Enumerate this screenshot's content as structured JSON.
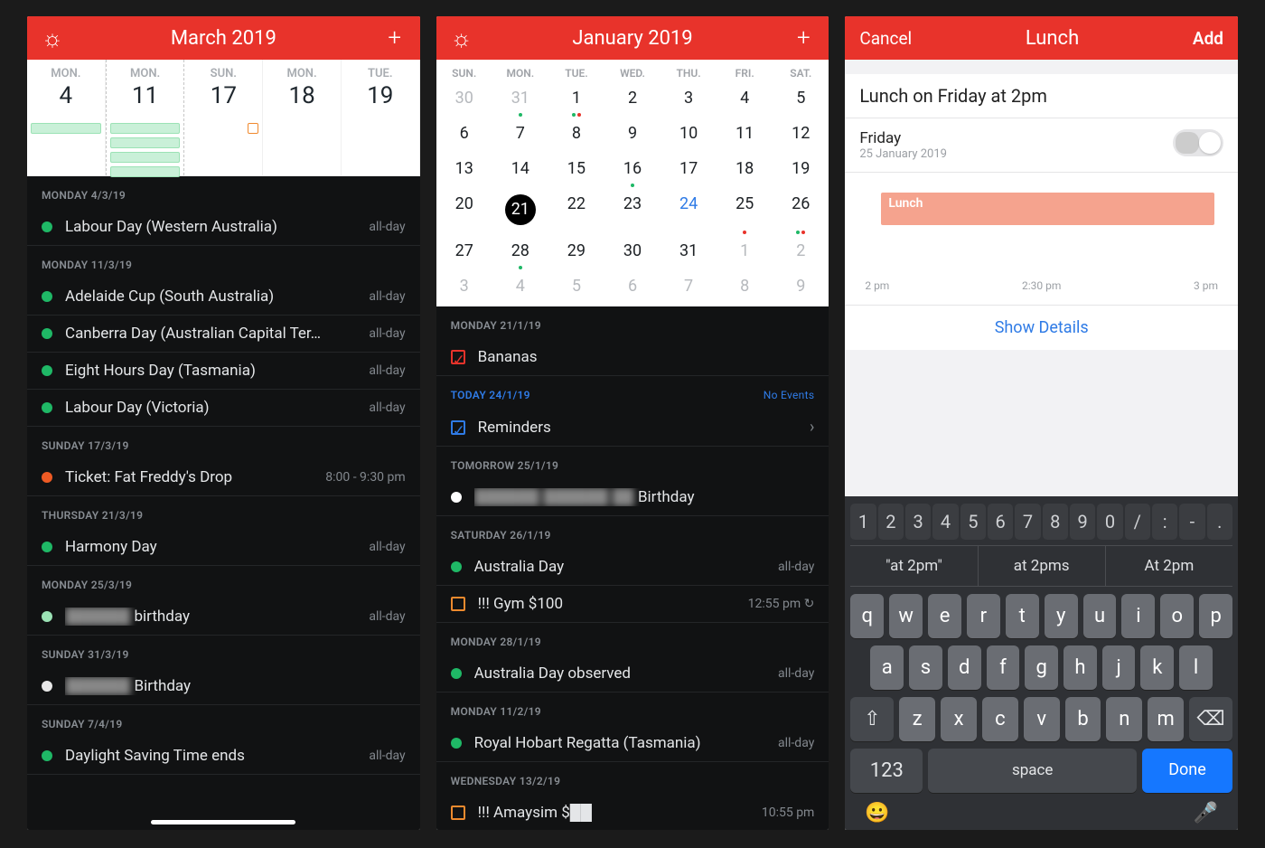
{
  "pane1": {
    "title": "March 2019",
    "days": [
      {
        "dow": "MON.",
        "num": "4"
      },
      {
        "dow": "MON.",
        "num": "11",
        "selected": true
      },
      {
        "dow": "SUN.",
        "num": "17"
      },
      {
        "dow": "MON.",
        "num": "18"
      },
      {
        "dow": "TUE.",
        "num": "19"
      }
    ],
    "groups": [
      {
        "hd": "MONDAY 4/3/19",
        "items": [
          {
            "c": "#1fb866",
            "t": "Labour Day (Western Australia)",
            "m": "all-day"
          }
        ]
      },
      {
        "hd": "MONDAY 11/3/19",
        "items": [
          {
            "c": "#1fb866",
            "t": "Adelaide Cup (South Australia)",
            "m": "all-day"
          },
          {
            "c": "#1fb866",
            "t": "Canberra Day (Australian Capital Ter…",
            "m": "all-day"
          },
          {
            "c": "#1fb866",
            "t": "Eight Hours Day (Tasmania)",
            "m": "all-day"
          },
          {
            "c": "#1fb866",
            "t": "Labour Day (Victoria)",
            "m": "all-day"
          }
        ]
      },
      {
        "hd": "SUNDAY 17/3/19",
        "items": [
          {
            "c": "#ee5a24",
            "t": "Ticket: Fat Freddy's Drop",
            "m": "8:00 - 9:30 pm"
          }
        ]
      },
      {
        "hd": "THURSDAY 21/3/19",
        "items": [
          {
            "c": "#1fb866",
            "t": "Harmony Day",
            "m": "all-day"
          }
        ]
      },
      {
        "hd": "MONDAY 25/3/19",
        "items": [
          {
            "c": "#9be2b5",
            "t": "birthday",
            "m": "all-day",
            "blur": true,
            "prefix": "██████"
          }
        ]
      },
      {
        "hd": "SUNDAY 31/3/19",
        "items": [
          {
            "c": "#e7e7e7",
            "t": "Birthday",
            "m": "",
            "blur": true,
            "prefix": "██████"
          }
        ]
      },
      {
        "hd": "SUNDAY 7/4/19",
        "items": [
          {
            "c": "#1fb866",
            "t": "Daylight Saving Time ends",
            "m": "all-day"
          }
        ]
      }
    ]
  },
  "pane2": {
    "title": "January 2019",
    "dow": [
      "SUN.",
      "MON.",
      "TUE.",
      "WED.",
      "THU.",
      "FRI.",
      "SAT."
    ],
    "grid": [
      [
        {
          "n": "30",
          "dim": 1
        },
        {
          "n": "31",
          "dim": 1,
          "d": [
            "#1fb866"
          ]
        },
        {
          "n": "1",
          "d": [
            "#1fb866",
            "#e8332b"
          ]
        },
        {
          "n": "2"
        },
        {
          "n": "3"
        },
        {
          "n": "4"
        },
        {
          "n": "5"
        }
      ],
      [
        {
          "n": "6"
        },
        {
          "n": "7"
        },
        {
          "n": "8"
        },
        {
          "n": "9"
        },
        {
          "n": "10"
        },
        {
          "n": "11"
        },
        {
          "n": "12"
        }
      ],
      [
        {
          "n": "13"
        },
        {
          "n": "14"
        },
        {
          "n": "15"
        },
        {
          "n": "16",
          "d": [
            "#1fb866"
          ]
        },
        {
          "n": "17"
        },
        {
          "n": "18"
        },
        {
          "n": "19"
        }
      ],
      [
        {
          "n": "20"
        },
        {
          "n": "21",
          "today": 1
        },
        {
          "n": "22"
        },
        {
          "n": "23"
        },
        {
          "n": "24",
          "blue": 1
        },
        {
          "n": "25",
          "d": [
            "#e8332b"
          ]
        },
        {
          "n": "26",
          "d": [
            "#1fb866",
            "#e8332b"
          ]
        }
      ],
      [
        {
          "n": "27"
        },
        {
          "n": "28",
          "d": [
            "#1fb866"
          ]
        },
        {
          "n": "29"
        },
        {
          "n": "30"
        },
        {
          "n": "31"
        },
        {
          "n": "1",
          "dim": 1
        },
        {
          "n": "2",
          "dim": 1
        }
      ],
      [
        {
          "n": "3",
          "dim": 1
        },
        {
          "n": "4",
          "dim": 1
        },
        {
          "n": "5",
          "dim": 1
        },
        {
          "n": "6",
          "dim": 1
        },
        {
          "n": "7",
          "dim": 1
        },
        {
          "n": "8",
          "dim": 1
        },
        {
          "n": "9",
          "dim": 1
        }
      ]
    ],
    "groups": [
      {
        "hd": "MONDAY 21/1/19",
        "items": [
          {
            "sq": "#e8332b",
            "check": true,
            "t": "Bananas"
          }
        ]
      },
      {
        "hd": "TODAY 24/1/19",
        "blue": true,
        "right": "No Events",
        "items": [
          {
            "sq": "#2f7be6",
            "check": true,
            "t": "Reminders",
            "chev": true
          }
        ]
      },
      {
        "hd": "TOMORROW 25/1/19",
        "items": [
          {
            "c": "#fff",
            "t": "Birthday",
            "blur": true,
            "prefix": "██████ ██████ ██"
          }
        ]
      },
      {
        "hd": "SATURDAY 26/1/19",
        "items": [
          {
            "c": "#1fb866",
            "t": "Australia Day",
            "m": "all-day"
          },
          {
            "sq": "#ee8a2e",
            "t": "!!! Gym $100",
            "m": "12:55 pm ↻"
          }
        ]
      },
      {
        "hd": "MONDAY 28/1/19",
        "items": [
          {
            "c": "#1fb866",
            "t": "Australia Day observed",
            "m": "all-day"
          }
        ]
      },
      {
        "hd": "MONDAY 11/2/19",
        "items": [
          {
            "c": "#1fb866",
            "t": "Royal Hobart Regatta (Tasmania)",
            "m": "all-day"
          }
        ]
      },
      {
        "hd": "WEDNESDAY 13/2/19",
        "items": [
          {
            "sq": "#ee8a2e",
            "t": "!!! Amaysim $██",
            "m": "10:55 pm",
            "blur": false
          }
        ]
      }
    ]
  },
  "pane3": {
    "cancel": "Cancel",
    "title": "Lunch",
    "add": "Add",
    "input": "Lunch on Friday at 2pm",
    "when_d1": "Friday",
    "when_d2": "25 January 2019",
    "eventlabel": "Lunch",
    "ticks": [
      "2 pm",
      "2:30 pm",
      "3 pm"
    ],
    "showdetails": "Show Details",
    "kb": {
      "nums": [
        "1",
        "2",
        "3",
        "4",
        "5",
        "6",
        "7",
        "8",
        "9",
        "0",
        "/",
        ":",
        "-",
        "."
      ],
      "sugg": [
        "\"at 2pm\"",
        "at 2pms",
        "At 2pm"
      ],
      "r1": [
        "q",
        "w",
        "e",
        "r",
        "t",
        "y",
        "u",
        "i",
        "o",
        "p"
      ],
      "r2": [
        "a",
        "s",
        "d",
        "f",
        "g",
        "h",
        "j",
        "k",
        "l"
      ],
      "r3": [
        "z",
        "x",
        "c",
        "v",
        "b",
        "n",
        "m"
      ],
      "shift": "⇧",
      "bksp": "⌫",
      "n123": "123",
      "space": "space",
      "done": "Done",
      "emoji": "😀",
      "mic": "🎤"
    }
  }
}
